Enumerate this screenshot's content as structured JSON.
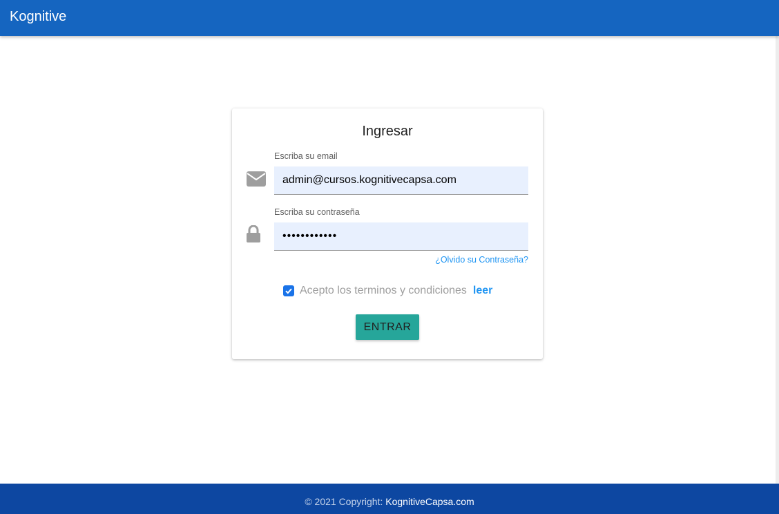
{
  "header": {
    "brand": "Kognitive"
  },
  "login": {
    "title": "Ingresar",
    "email": {
      "label": "Escriba su email",
      "value": "admin@cursos.kognitivecapsa.com"
    },
    "password": {
      "label": "Escriba su contraseña",
      "value": "passwordxyz1"
    },
    "forgot_link": "¿Olvido su Contraseña?",
    "terms": {
      "checked": true,
      "text": "Acepto los terminos y condiciones",
      "link": "leer"
    },
    "submit_label": "ENTRAR"
  },
  "footer": {
    "copyright": "© 2021 Copyright: ",
    "link": "KognitiveCapsa.com"
  },
  "icons": {
    "email": "envelope-icon",
    "password": "lock-icon",
    "check": "check-icon"
  },
  "colors": {
    "header": "#1565c0",
    "footer": "#0d47a1",
    "accent": "#26a69a",
    "link": "#2196f3",
    "input_bg": "#e8f0fe"
  }
}
